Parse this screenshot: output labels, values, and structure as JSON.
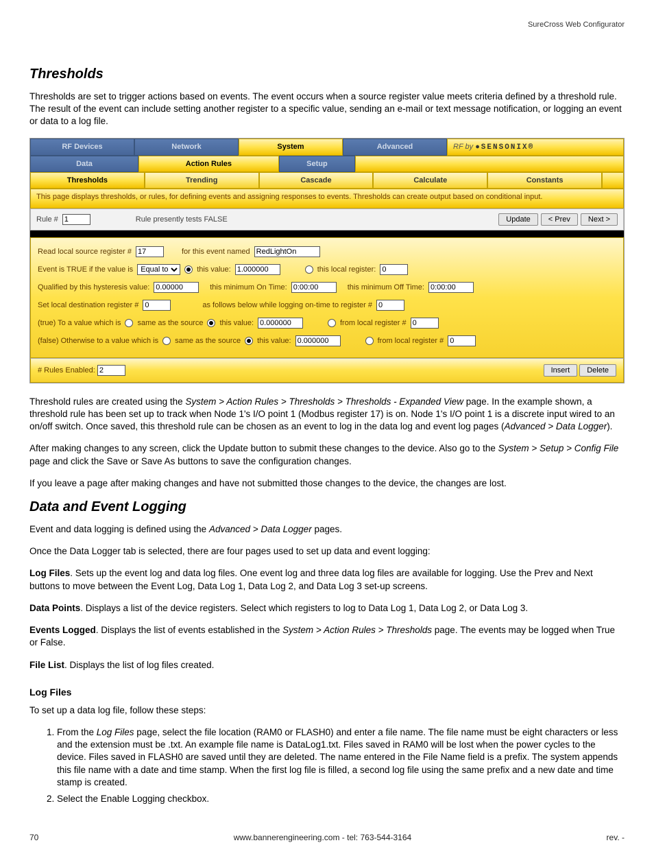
{
  "header": {
    "product": "SureCross Web Configurator"
  },
  "sections": {
    "thresholds": {
      "title": "Thresholds",
      "intro": "Thresholds are set to trigger actions based on events. The event occurs when a source register value meets criteria defined by a threshold rule. The result of the event can include setting another register to a specific value, sending an e-mail or text message notification, or logging an event or data to a log file.",
      "after1_a": "Threshold rules are created using the ",
      "after1_path": "System > Action Rules > Thresholds > Thresholds - Expanded View",
      "after1_b": " page. In the example shown, a threshold rule has been set up to track when Node 1's I/O point 1 (Modbus register 17) is on. Node 1's I/O point 1 is a discrete input wired to an on/off switch. Once saved, this threshold rule can be chosen as an event to log in the data log and event log pages (",
      "after1_c": "Advanced > Data Logger",
      "after1_d": ").",
      "after2_a": "After making changes to any screen, click the Update button to submit these changes to the device. Also go to the ",
      "after2_path": "System > Setup > Config File",
      "after2_b": " page and click the Save or Save As buttons to save the configuration changes.",
      "after3": "If you leave a page after making changes and have not submitted those changes to the device, the changes are lost."
    },
    "logging": {
      "title": "Data and Event Logging",
      "intro_a": "Event and data logging is defined using the ",
      "intro_path": "Advanced > Data Logger",
      "intro_b": " pages.",
      "p2": "Once the Data Logger tab is selected, there are four pages used to set up data and event logging:",
      "logfiles_label": "Log Files",
      "logfiles_text": ". Sets up the event log and data log files. One event log and three data log files are available for logging. Use the Prev and Next buttons to move between the Event Log, Data Log 1, Data Log 2, and Data Log 3 set-up screens.",
      "datapoints_label": "Data Points",
      "datapoints_text": ". Displays a list of the device registers. Select which registers to log to Data Log 1, Data Log 2, or Data Log 3.",
      "events_label": "Events Logged",
      "events_text_a": ". Displays the list of events established in the ",
      "events_path": "System > Action Rules > Thresholds",
      "events_text_b": " page. The events may be logged when True or False.",
      "filelist_label": "File List",
      "filelist_text": ". Displays the list of log files created.",
      "sub_title": "Log Files",
      "sub_intro": "To set up a data log file, follow these steps:",
      "step1_a": "From the ",
      "step1_i": "Log Files",
      "step1_b": " page, select the file location (RAM0 or FLASH0) and enter a file name. The file name must be eight characters or less and the extension must be .txt. An example file name is DataLog1.txt. Files saved in RAM0 will be lost when the power cycles to the device. Files saved in FLASH0 are saved until they are deleted. The name entered in the File Name field is a prefix. The system appends this file name with a date and time stamp. When the first log file is filled, a second log file using the same prefix and a new date and time stamp is created.",
      "step2": "Select the Enable Logging checkbox."
    }
  },
  "config": {
    "tabs_top": [
      "RF Devices",
      "Network",
      "System",
      "Advanced"
    ],
    "brand_prefix": "RF by ",
    "brand_logo": "●SENSONIX®",
    "tabs_mid": [
      "Data",
      "Action Rules",
      "Setup"
    ],
    "tabs_bot": [
      "Thresholds",
      "Trending",
      "Cascade",
      "Calculate",
      "Constants"
    ],
    "desc": "This page displays thresholds, or rules, for defining events and assigning responses to events. Thresholds can create output based on conditional input.",
    "rule_bar": {
      "label": "Rule #",
      "value": "1",
      "status": "Rule presently tests FALSE",
      "btn_update": "Update",
      "btn_prev": "< Prev",
      "btn_next": "Next >"
    },
    "form": {
      "row1_a": "Read local source register #",
      "row1_val": "17",
      "row1_b": "for this event named",
      "row1_name": "RedLightOn",
      "row2_a": "Event is TRUE if the value is",
      "row2_sel": "Equal to",
      "row2_b": "this value:",
      "row2_val": "1.000000",
      "row2_c": "this local register:",
      "row2_reg": "0",
      "row3_a": "Qualified by this hysteresis value:",
      "row3_hy": "0.00000",
      "row3_b": "this minimum On Time:",
      "row3_on": "0:00:00",
      "row3_c": "this minimum Off Time:",
      "row3_off": "0:00:00",
      "row4_a": "Set local destination register #",
      "row4_reg": "0",
      "row4_b": "as follows below while logging on-time to register #",
      "row4_log": "0",
      "row5_a": "(true) To a value which is",
      "row5_opt1": "same as the source",
      "row5_opt2": "this value:",
      "row5_val": "0.000000",
      "row5_opt3": "from local register #",
      "row5_reg": "0",
      "row6_a": "(false) Otherwise to a value which is",
      "row6_opt1": "same as the source",
      "row6_opt2": "this value:",
      "row6_val": "0.000000",
      "row6_opt3": "from local register #",
      "row6_reg": "0"
    },
    "footer": {
      "label": "# Rules Enabled:",
      "value": "2",
      "btn_insert": "Insert",
      "btn_delete": "Delete"
    }
  },
  "pagefoot": {
    "pageno": "70",
    "center": "www.bannerengineering.com - tel: 763-544-3164",
    "right": "rev. -"
  }
}
